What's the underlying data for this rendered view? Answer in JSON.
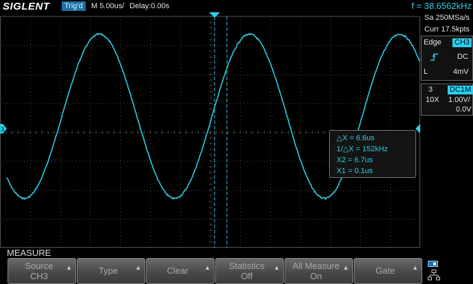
{
  "header": {
    "logo": "SIGLENT",
    "trigger_status": "Trig'd",
    "timebase": "M 5.00us/",
    "delay": "Delay:0.00s",
    "frequency": "f = 38.6562kHz"
  },
  "acquisition": {
    "sample_rate": "Sa 250MSa/s",
    "memory": "Curr 17.5kpts"
  },
  "trigger": {
    "type": "Edge",
    "source": "CH3",
    "coupling": "DC",
    "mode_letter": "L",
    "level": "4mV"
  },
  "channel": {
    "number": "3",
    "coupling": "DC1M",
    "probe": "10X",
    "scale": "1.00V/",
    "offset": "0.0V"
  },
  "cursor_measure": {
    "delta_x": "△X = 6.6us",
    "inv_delta_x": "1/△X = 152kHz",
    "x2": "X2 = 6.7us",
    "x1": "X1 = 0.1us"
  },
  "menu": {
    "title": "MEASURE",
    "softkeys": [
      {
        "line1": "Source",
        "line2": "CH3"
      },
      {
        "line1": "Type",
        "line2": ""
      },
      {
        "line1": "Clear",
        "line2": ""
      },
      {
        "line1": "Statistics",
        "line2": "Off"
      },
      {
        "line1": "All Measure",
        "line2": "On"
      },
      {
        "line1": "Gate",
        "line2": ""
      }
    ]
  },
  "markers": {
    "channel_ground": "3"
  },
  "colors": {
    "trace": "#29d0e6",
    "grid": "#3a3a3a",
    "accent": "#1f6fa8"
  }
}
